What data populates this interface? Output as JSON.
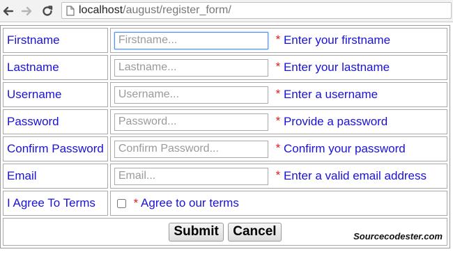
{
  "browser": {
    "address_host": "localhost",
    "address_path": "/august/register_form/"
  },
  "icons": {
    "back": "arrow-left-icon",
    "forward": "arrow-right-icon",
    "reload": "reload-icon",
    "page": "page-icon"
  },
  "colors": {
    "label": "#1a12d8",
    "required": "#e0181c",
    "focus": "#4d90fe"
  },
  "form": {
    "rows": [
      {
        "label": "Firstname",
        "placeholder": "Firstname...",
        "required": "*",
        "hint": "Enter your firstname"
      },
      {
        "label": "Lastname",
        "placeholder": "Lastname...",
        "required": "*",
        "hint": "Enter your lastname"
      },
      {
        "label": "Username",
        "placeholder": "Username...",
        "required": "*",
        "hint": "Enter a username"
      },
      {
        "label": "Password",
        "placeholder": "Password...",
        "required": "*",
        "hint": "Provide a password"
      },
      {
        "label": "Confirm Password",
        "placeholder": "Confirm Password...",
        "required": "*",
        "hint": "Confirm your password"
      },
      {
        "label": "Email",
        "placeholder": "Email...",
        "required": "*",
        "hint": "Enter a valid email address"
      }
    ],
    "terms": {
      "label": "I Agree To Terms",
      "required": "*",
      "hint": "Agree to our terms"
    },
    "submit_label": "Submit",
    "cancel_label": "Cancel",
    "watermark": "Sourcecodester.com"
  }
}
